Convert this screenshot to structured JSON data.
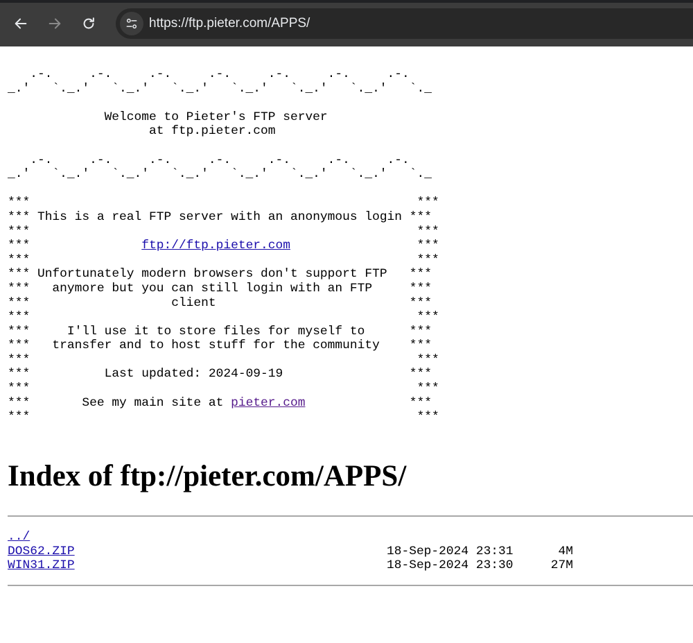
{
  "browser": {
    "url": "https://ftp.pieter.com/APPS/",
    "icons": {
      "back": "arrow-left-icon",
      "forward": "arrow-right-icon",
      "reload": "reload-icon",
      "site_info": "tune-icon"
    },
    "colors": {
      "chrome": "#3c3c3c",
      "omnibox": "#282828",
      "text": "#e8eaed"
    }
  },
  "banner": {
    "wave_top": "   .-.     .-.     .-.     .-.     .-.     .-.     .-.\n_.'   `._.'   `._.'   `._.'   `._.'   `._.'   `._.'   `._",
    "welcome_1": "             Welcome to Pieter's FTP server",
    "welcome_2": "                   at ftp.pieter.com",
    "wave_bottom": "   .-.     .-.     .-.     .-.     .-.     .-.     .-.\n_.'   `._.'   `._.'   `._.'   `._.'   `._.'   `._.'   `._",
    "stars": "***",
    "line_real": " This is a real FTP server with an anonymous login ",
    "ftp_link": "ftp://ftp.pieter.com",
    "line_unfort_1": " Unfortunately modern browsers don't support FTP   ",
    "line_unfort_2": "   anymore but you can still login with an FTP     ",
    "line_unfort_3": "                   client                          ",
    "line_store_1": "     I'll use it to store files for myself to      ",
    "line_store_2": "   transfer and to host stuff for the community    ",
    "line_updated": "          Last updated: 2024-09-19                 ",
    "see_main_prefix": "       See my main site at ",
    "site_link": "pieter.com"
  },
  "index": {
    "title": "Index of ftp://pieter.com/APPS/",
    "rows": [
      {
        "name": "../",
        "date": "",
        "size": ""
      },
      {
        "name": "DOS62.ZIP",
        "date": "18-Sep-2024 23:31",
        "size": "4M"
      },
      {
        "name": "WIN31.ZIP",
        "date": "18-Sep-2024 23:30",
        "size": "27M"
      }
    ]
  },
  "colors": {
    "link": "#1a0dab",
    "visited_link": "#551a8b",
    "rule": "#a8a8a8"
  }
}
